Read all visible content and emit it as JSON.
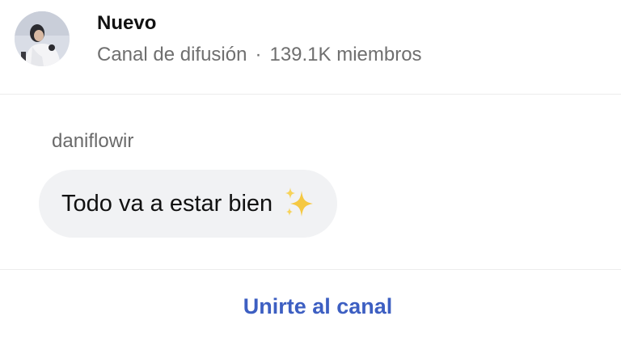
{
  "channel": {
    "name": "Nuevo",
    "type_label": "Canal de difusión",
    "separator": "·",
    "members_label": "139.1K miembros"
  },
  "message": {
    "author": "daniflowir",
    "text": "Todo va a estar bien",
    "emoji_icon": "sparkles-icon"
  },
  "footer": {
    "join_label": "Unirte al canal"
  },
  "colors": {
    "accent": "#3d5fc2",
    "bubble": "#f1f2f4",
    "sparkle": "#f5c842"
  }
}
